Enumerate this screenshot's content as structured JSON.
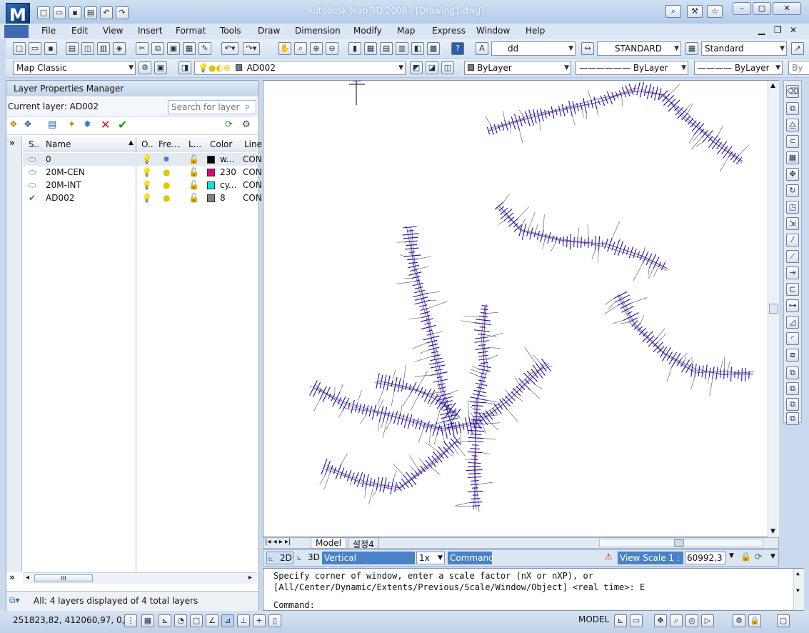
{
  "title": {
    "app_logo": "M",
    "window_title": "Autodesk Map 3D 2008 - [Drawing1.dwg]"
  },
  "menu": [
    "File",
    "Edit",
    "View",
    "Insert",
    "Format",
    "Tools",
    "Draw",
    "Dimension",
    "Modify",
    "Map",
    "Express",
    "Window",
    "Help"
  ],
  "toolbar": {
    "text_style": "dd",
    "dim_style": "STANDARD",
    "table_style": "Standard",
    "workspace": "Map Classic",
    "current_layer_combo": "AD002",
    "color": "ByLayer",
    "linetype": "ByLayer",
    "lineweight": "ByLayer",
    "plotstyle": "By"
  },
  "lpm": {
    "title": "Layer Properties Manager",
    "current_layer": "Current layer: AD002",
    "search_placeholder": "Search for layer",
    "left_toggle": "»",
    "columns": {
      "status": "S..",
      "name": "Name",
      "on": "O..",
      "freeze": "Fre...",
      "lock": "L...",
      "color": "Color",
      "linetype": "Line"
    },
    "layers": [
      {
        "name": "0",
        "color_name": "w...",
        "color_hex": "#000000",
        "linetype": "CON"
      },
      {
        "name": "20M-CEN",
        "color_name": "230",
        "color_hex": "#e00070",
        "linetype": "CON"
      },
      {
        "name": "20M-INT",
        "color_name": "cy...",
        "color_hex": "#00e5e5",
        "linetype": "CON"
      },
      {
        "name": "AD002",
        "color_name": "8",
        "color_hex": "#808080",
        "linetype": "CON"
      }
    ],
    "scroll_thumb": "III",
    "footer": "All: 4 layers displayed of 4 total layers"
  },
  "tabs": {
    "model": "Model",
    "layout": "설정4"
  },
  "drawing_status": {
    "btn_2d": "2D",
    "btn_3d": "3D",
    "vert_exag": "Vertical Exaggeration:",
    "vert_val": "1x",
    "command_label": "Command",
    "view_scale": "View Scale  1 :",
    "view_scale_val": "60992,3"
  },
  "command": {
    "line1": "Specify corner of window, enter a scale factor (nX or nXP), or",
    "line2": "[All/Center/Dynamic/Extents/Previous/Scale/Window/Object] <real time>: E",
    "prompt": "Command:"
  },
  "status": {
    "coords": "251823,82, 412060,97, 0,00",
    "model": "MODEL"
  },
  "colors": {
    "route": "#1010c8",
    "terrain": "#555555",
    "route_center": "#c00060"
  }
}
